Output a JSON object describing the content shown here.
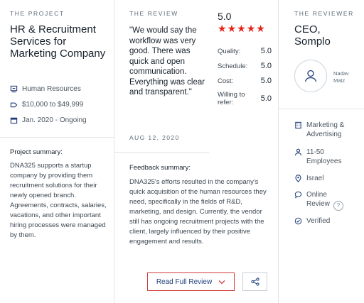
{
  "project": {
    "heading": "THE PROJECT",
    "title": "HR & Recruitment Services for Marketing Company",
    "service": "Human Resources",
    "budget": "$10,000 to $49,999",
    "dates": "Jan. 2020 - Ongoing",
    "summary_label": "Project summary:",
    "summary_text": "DNA325 supports a startup company by providing them recruitment solutions for their newly opened branch. Agreements, contracts, salaries, vacations, and other important hiring processes were managed by them."
  },
  "review": {
    "heading": "THE REVIEW",
    "quote": "\"We would say the workflow was very good. There was quick and open communication. Everything was clear and transparent.\"",
    "date": "AUG 12, 2020",
    "overall": "5.0",
    "stars": 5,
    "scores": [
      {
        "label": "Quality:",
        "value": "5.0"
      },
      {
        "label": "Schedule:",
        "value": "5.0"
      },
      {
        "label": "Cost:",
        "value": "5.0"
      },
      {
        "label": "Willing to refer:",
        "value": "5.0"
      }
    ],
    "feedback_label": "Feedback summary:",
    "feedback_text": "DNA325's efforts resulted in the company's quick acquisition of the human resources they need, specifically in the fields of R&D, marketing, and design. Currently, the vendor still has ongoing recruitment projects with the client, largely influenced by their positive engagement and results.",
    "read_button": "Read Full Review"
  },
  "reviewer": {
    "heading": "THE REVIEWER",
    "title": "CEO, Somplo",
    "name": "Nadav Matz",
    "industry": "Marketing & Advertising",
    "size": "11-50 Employees",
    "location": "Israel",
    "review_type": "Online Review",
    "status": "Verified"
  },
  "colors": {
    "star": "#e62117",
    "button_border": "#d23a3a",
    "link": "#1f3d7a"
  }
}
